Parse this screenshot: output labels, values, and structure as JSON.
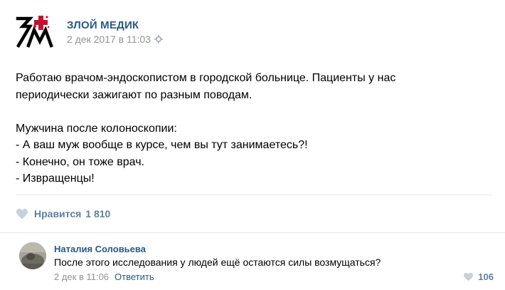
{
  "post": {
    "author": "ЗЛОЙ МЕДИК",
    "logo_text": "ЗМ",
    "date": "2 дек 2017 в 11:03",
    "paragraph1": [
      "Работаю врачом-эндоскопистом в городской больнице. Пациенты у нас",
      "периодически зажигают по разным поводам."
    ],
    "paragraph2": [
      "Мужчина после колоноскопии:",
      "- А ваш муж вообще в курсе, чем вы тут занимаетесь?!",
      "- Конечно, он тоже врач.",
      "- Извращенцы!"
    ],
    "likes_label": "Нравится",
    "likes_count": "1 810"
  },
  "comment": {
    "author": "Наталия Соловьева",
    "text": "После этого исследования у людей ещё остаются силы возмущаться?",
    "date": "2 дек в 11:06",
    "reply_label": "Ответить",
    "likes_count": "106"
  },
  "icons": {
    "settings": "gear-icon",
    "like": "heart-icon"
  },
  "colors": {
    "link": "#2a5885",
    "muted": "#939393",
    "like": "#5e7fa5",
    "logo_red": "#c8102e"
  }
}
